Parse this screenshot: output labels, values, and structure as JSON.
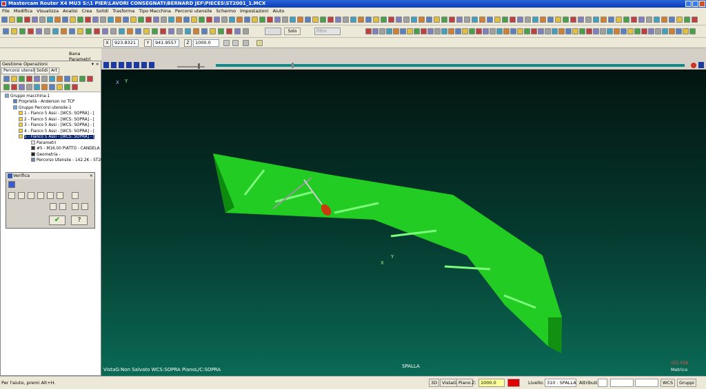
{
  "window": {
    "title": "Mastercam Router X4 MU3  S:\\1 PIER\\LAVORI CONSEGNATI\\BERNARD JEF\\PIECES\\ST2001_1.MCX"
  },
  "menu": [
    "File",
    "Modifica",
    "Visualizza",
    "Analisi",
    "Crea",
    "Solidi",
    "Trasforma",
    "Tipo Macchina",
    "Percorsi utensile",
    "Schermo",
    "Impostazioni",
    "Aiuto"
  ],
  "toolbar": {
    "solo_label": "Solo",
    "filtro_label": "Filtro"
  },
  "coords": {
    "x": "923.8321",
    "y": "941.9557",
    "z": "1000.0",
    "x_label": "X",
    "y_label": "Y",
    "z_label": "Z"
  },
  "bana_parametri": "Bana Parametri",
  "ops": {
    "header": "Gestione Operazioni",
    "tabs": [
      "Percorsi utensile",
      "Solidi",
      "Art"
    ],
    "tree": [
      "Gruppo macchina-1",
      "Proprietà - Anderson no TCP",
      "Gruppo Percorsi utensile-1",
      "1 - Fianco 5 Assi - [WCS: SOPRA] - [",
      "2 - Fianco 5 Assi - [WCS: SOPRA] - [",
      "3 - Fianco 5 Assi - [WCS: SOPRA] - [",
      "4 - Fianco 5 Assi - [WCS: SOPRA] - [",
      "5 - Fianco 5 Assi - [WCS: SOPRA] - [",
      "Parametri",
      "#5 - M16.00 PIATTO - CANDELA",
      "Geometria -",
      "Percorso Utensile - 142.2K - ST20"
    ]
  },
  "verifica": {
    "title": "Verifica"
  },
  "viewport": {
    "status": "VistaG:Non Salvato    WCS:SOPRA    PianoL/C:SOPRA",
    "label": "SPALLA",
    "scale": "155.558",
    "units": "Metrico",
    "axis_x": "X",
    "axis_y": "Y"
  },
  "statusbar": {
    "hint": "Per l'aiuto, premi Alt+H.",
    "b3d": "3D",
    "vistag": "VistaG",
    "piano": "Piano",
    "z_label": "Z:",
    "z_value": "1000.0",
    "livello_label": "Livello:",
    "livello_value": "310 : SPALLA",
    "attributi": "Attributi",
    "wcs": "WCS",
    "gruppi": "Gruppi"
  },
  "colors": {
    "part": "#22cc22",
    "part_dark": "#0e8a10",
    "tool": "#cc3a10",
    "bg_top": "#03120e",
    "bg_bottom": "#0a6a55"
  }
}
